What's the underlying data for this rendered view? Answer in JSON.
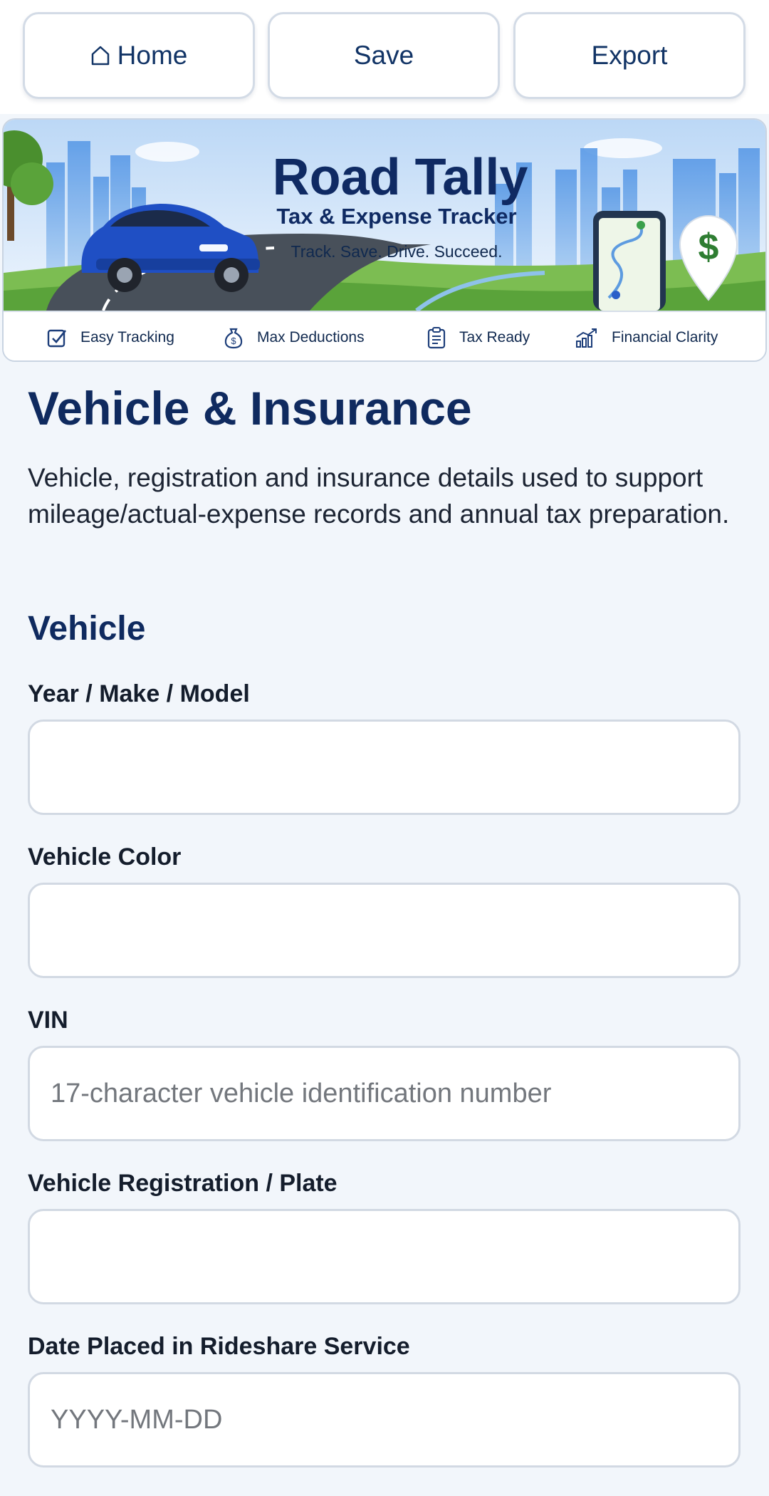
{
  "nav": {
    "home_label": "Home",
    "save_label": "Save",
    "export_label": "Export"
  },
  "banner": {
    "title": "Road Tally",
    "subtitle": "Tax & Expense Tracker",
    "tagline": "Track. Save. Drive. Succeed.",
    "features": [
      {
        "label": "Easy Tracking",
        "icon": "checkbox-icon"
      },
      {
        "label": "Max Deductions",
        "icon": "money-bag-icon"
      },
      {
        "label": "Tax Ready",
        "icon": "clipboard-icon"
      },
      {
        "label": "Financial Clarity",
        "icon": "growth-chart-icon"
      }
    ]
  },
  "page": {
    "title": "Vehicle & Insurance",
    "description": "Vehicle, registration and insurance details used to support mileage/actual-expense records and annual tax preparation."
  },
  "vehicle_section": {
    "title": "Vehicle",
    "fields": [
      {
        "label": "Year / Make / Model",
        "value": "",
        "placeholder": ""
      },
      {
        "label": "Vehicle Color",
        "value": "",
        "placeholder": ""
      },
      {
        "label": "VIN",
        "value": "",
        "placeholder": "17-character vehicle identification number"
      },
      {
        "label": "Vehicle Registration / Plate",
        "value": "",
        "placeholder": ""
      },
      {
        "label": "Date Placed in Rideshare Service",
        "value": "",
        "placeholder": "YYYY-MM-DD"
      }
    ]
  },
  "colors": {
    "accent": "#0f2a5f",
    "background": "#f2f6fb",
    "car": "#1f4fc4",
    "money_pin": "#2e7d32"
  }
}
